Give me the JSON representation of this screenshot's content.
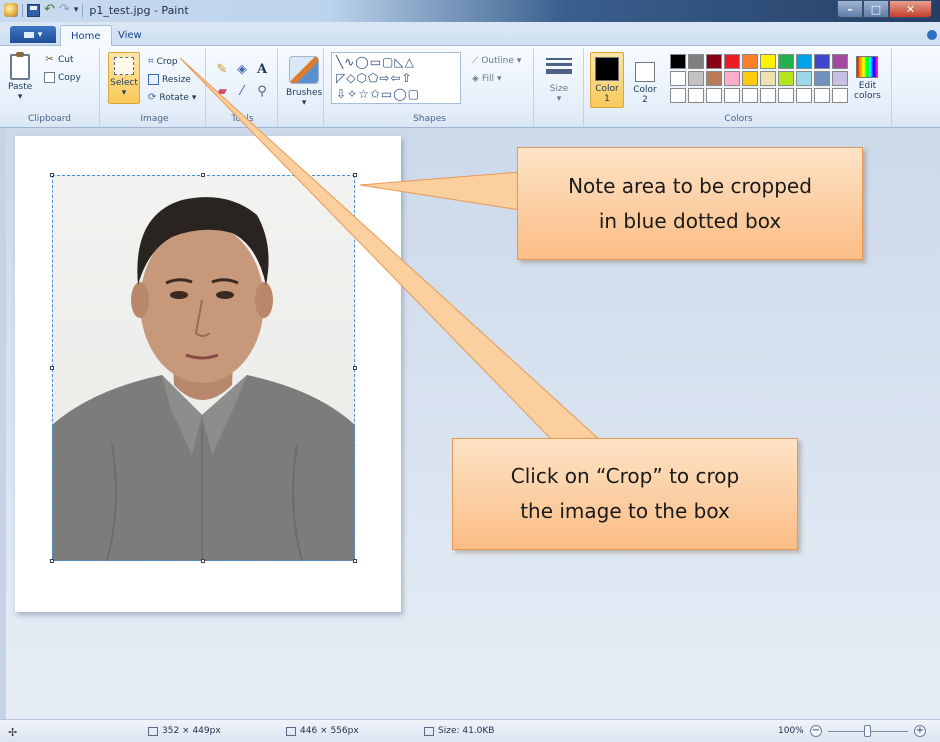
{
  "window": {
    "title": "p1_test.jpg - Paint",
    "controls": {
      "minimize": "–",
      "maximize": "□",
      "close": "✕"
    }
  },
  "tabs": [
    {
      "label": "Home",
      "active": true
    },
    {
      "label": "View",
      "active": false
    }
  ],
  "ribbon": {
    "clipboard": {
      "paste": "Paste",
      "cut": "Cut",
      "copy": "Copy",
      "group_label": "Clipboard"
    },
    "image": {
      "select": "Select",
      "crop": "Crop",
      "resize": "Resize",
      "rotate": "Rotate",
      "group_label": "Image"
    },
    "tools": {
      "group_label": "Tools"
    },
    "brushes": {
      "label": "Brushes"
    },
    "shapes": {
      "rows": [
        "╲∿◯▭▢◺△",
        "◸◇⬡⬠⇨⇦⇧",
        "⇩✧☆✩▭◯▢"
      ],
      "outline": "Outline",
      "fill": "Fill",
      "group_label": "Shapes"
    },
    "size": {
      "label": "Size"
    },
    "colors": {
      "color1_line1": "Color",
      "color1_line2": "1",
      "color2_line1": "Color",
      "color2_line2": "2",
      "edit_line1": "Edit",
      "edit_line2": "colors",
      "group_label": "Colors",
      "color1": "#000000",
      "color2": "#ffffff",
      "palette": [
        "#000000",
        "#7f7f7f",
        "#880015",
        "#ed1c24",
        "#ff7f27",
        "#fff200",
        "#22b14c",
        "#00a2e8",
        "#3f48cc",
        "#a349a4",
        "#ffffff",
        "#c3c3c3",
        "#b97a57",
        "#ffaec9",
        "#ffc90e",
        "#efe4b0",
        "#b5e61d",
        "#99d9ea",
        "#7092be",
        "#c8bfe7",
        "#ffffff",
        "#ffffff",
        "#ffffff",
        "#ffffff",
        "#ffffff",
        "#ffffff",
        "#ffffff",
        "#ffffff",
        "#ffffff",
        "#ffffff"
      ]
    }
  },
  "callouts": {
    "top": {
      "line1": "Note area to be cropped",
      "line2": "in blue dotted box"
    },
    "bottom": {
      "line1": "Click on “Crop” to crop",
      "line2": "the image to the box"
    }
  },
  "status": {
    "selection_size": "352 × 449px",
    "image_size": "446 × 556px",
    "file_size": "Size: 41.0KB",
    "zoom": "100%",
    "zoom_level": 1.0
  }
}
